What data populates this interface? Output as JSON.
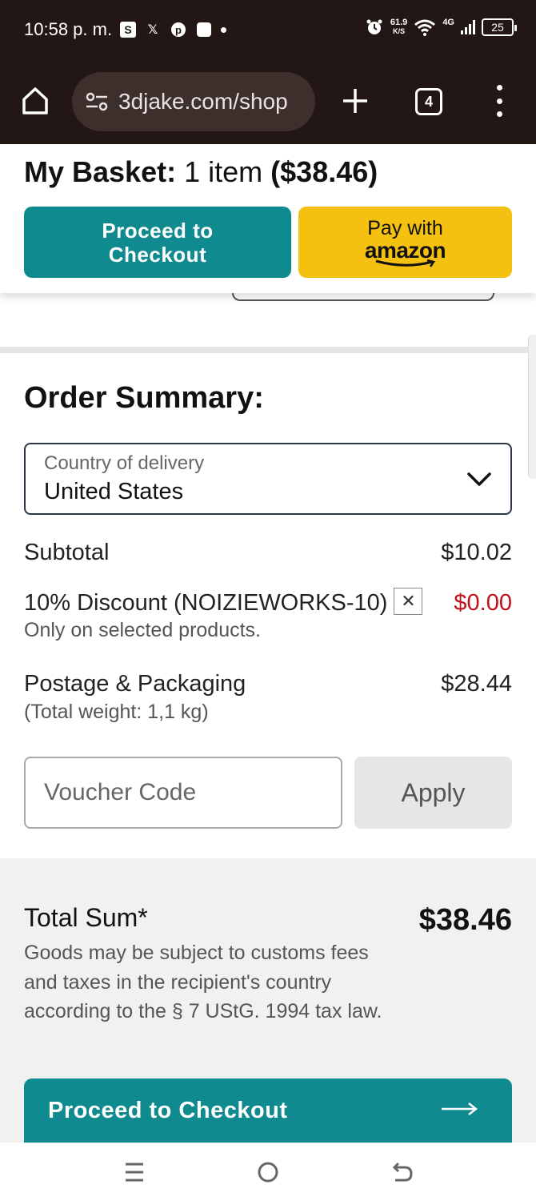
{
  "status_bar": {
    "time": "10:58 p. m.",
    "net_speed_value": "61.9",
    "net_speed_unit": "K/S",
    "network_type": "4G",
    "battery": "25"
  },
  "browser": {
    "url": "3djake.com/shop",
    "tab_count": "4"
  },
  "basket": {
    "title_bold": "My Basket:",
    "item_count": "1 item",
    "total_bold": "($38.46)",
    "checkout_label_line1": "Proceed to",
    "checkout_label_line2": "Checkout",
    "amazon_pay_label": "Pay with",
    "amazon_brand": "amazon"
  },
  "order_summary": {
    "title": "Order Summary:",
    "country_label": "Country of delivery",
    "country_value": "United States",
    "subtotal_label": "Subtotal",
    "subtotal_value": "$10.02",
    "discount_label": "10% Discount (NOIZIEWORKS-10)",
    "discount_value": "$0.00",
    "discount_note": "Only on selected products.",
    "postage_label": "Postage & Packaging",
    "postage_value": "$28.44",
    "postage_note": "(Total weight: 1,1 kg)",
    "voucher_placeholder": "Voucher Code",
    "apply_label": "Apply"
  },
  "total": {
    "label": "Total Sum*",
    "value": "$38.46",
    "note": "Goods may be subject to customs fees and taxes in the recipient's country according to the § 7 UStG. 1994 tax law.",
    "checkout_label": "Proceed to Checkout"
  },
  "colors": {
    "teal": "#0f8a8e",
    "amazon_yellow": "#f5c110",
    "discount_red": "#c0101b",
    "chrome_dark": "#231715"
  }
}
